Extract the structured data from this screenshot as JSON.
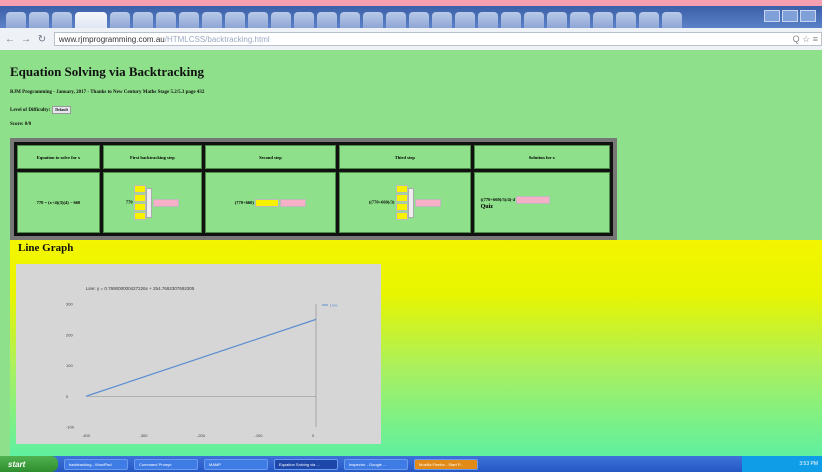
{
  "browser": {
    "url_host": "www.rjmprogramming.com.au",
    "url_path": "/HTMLCSS/backtracking.html",
    "addr_right": "Q ☆ ≡"
  },
  "page": {
    "title": "Equation Solving via Backtracking",
    "credit": "RJM Programming - January, 2017 - Thanks to New Century Maths Stage 5.2/5.3 page 432",
    "level_label": "Level of Difficulty:",
    "level_value": "Default",
    "score": "Score: 0/0"
  },
  "table": {
    "headers": [
      "Equation to solve for x",
      "First backtracking step",
      "Second step",
      "Third step",
      "Solution for x"
    ],
    "equation": "770 = (x+4)(3)(4) − 660",
    "step1_label": "770",
    "step2_label": "(770+660)",
    "step3_label": "((770+660)/3)",
    "solution_label": "((770+660)/3)/4)-4",
    "solution_button": "Quiz"
  },
  "graph": {
    "heading": "Line Graph"
  },
  "chart_data": {
    "type": "line",
    "title": "Line: y = 0.769000000427226x + 254.7692307692305",
    "x": [
      -400,
      0
    ],
    "series": [
      {
        "name": "Line",
        "values": [
          0,
          250
        ]
      }
    ],
    "xticks": [
      "-400",
      "-300",
      "-200",
      "-100",
      "0"
    ],
    "yticks": [
      "300",
      "200",
      "100",
      "0",
      "-100"
    ],
    "xlim": [
      -400,
      0
    ],
    "ylim": [
      -100,
      300
    ],
    "color": "#5b8ed1",
    "legend": "right"
  },
  "taskbar": {
    "start": "start",
    "tasks": [
      {
        "label": "backtracking - WordPad",
        "style": "normal"
      },
      {
        "label": "Command Prompt",
        "style": "normal"
      },
      {
        "label": "MAMP",
        "style": "normal"
      },
      {
        "label": "Equation Solving via ...",
        "style": "active"
      },
      {
        "label": "Inspector - Google ...",
        "style": "normal"
      },
      {
        "label": "Mozilla Firefox - Start P...",
        "style": "orange"
      }
    ],
    "clock": "3:53 PM"
  }
}
